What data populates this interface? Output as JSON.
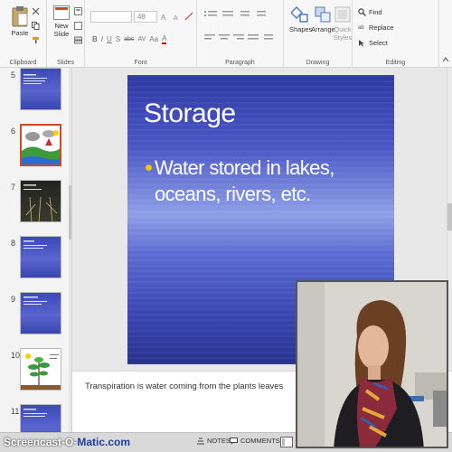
{
  "ribbon": {
    "clipboard": {
      "paste": "Paste",
      "label": "Clipboard"
    },
    "slides": {
      "new_slide_line1": "New",
      "new_slide_line2": "Slide",
      "label": "Slides"
    },
    "font": {
      "size": "48",
      "label": "Font",
      "buttons": [
        "B",
        "I",
        "U",
        "S",
        "abc",
        "AV",
        "Aa",
        "A"
      ]
    },
    "paragraph": {
      "label": "Paragraph"
    },
    "drawing": {
      "shapes": "Shapes",
      "arrange": "Arrange",
      "quick_line1": "Quick",
      "quick_line2": "Styles",
      "label": "Drawing"
    },
    "editing": {
      "find": "Find",
      "replace": "Replace",
      "select": "Select",
      "label": "Editing"
    }
  },
  "thumbnails": [
    {
      "num": "5",
      "title": "",
      "body": ""
    },
    {
      "num": "6",
      "title": "",
      "body": ""
    },
    {
      "num": "7",
      "title": "",
      "body": ""
    },
    {
      "num": "8",
      "title": "",
      "body": ""
    },
    {
      "num": "9",
      "title": "",
      "body": ""
    },
    {
      "num": "10",
      "title": "",
      "body": ""
    },
    {
      "num": "11",
      "title": "",
      "body": ""
    }
  ],
  "slide": {
    "title": "Storage",
    "bullet": "Water stored in lakes, oceans, rivers, etc."
  },
  "notes": {
    "text": "Transpiration is water coming from the plants leaves"
  },
  "status": {
    "watermark_a": "Screencast-O-",
    "watermark_b": "Matic.com",
    "notes": "NOTES",
    "comments": "COMMENTS"
  },
  "colors": {
    "accent": "#d24726",
    "bullet": "#f4c400",
    "slide_blue": "#3b49b9"
  }
}
